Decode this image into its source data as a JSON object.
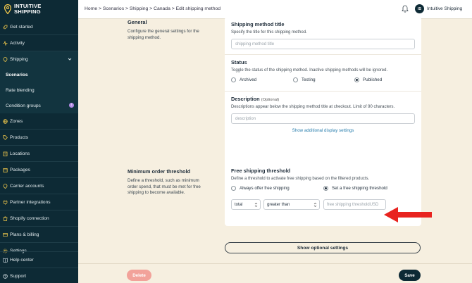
{
  "app": {
    "logo_line1": "Intuitive",
    "logo_line2": "Shipping"
  },
  "header": {
    "breadcrumb": "Home > Scenarios > Shipping > Canada > Edit shipping method",
    "avatar_initials": "IS",
    "user_name": "Intuitive Shipping"
  },
  "sidebar": {
    "items": [
      {
        "label": "Get started",
        "icon": "rocket-icon"
      },
      {
        "label": "Activity",
        "icon": "pulse-icon"
      },
      {
        "label": "Shipping",
        "icon": "pin-icon"
      },
      {
        "label": "Scenarios"
      },
      {
        "label": "Rate blending"
      },
      {
        "label": "Condition groups"
      },
      {
        "label": "Zones",
        "icon": "globe-icon"
      },
      {
        "label": "Products",
        "icon": "tag-icon"
      },
      {
        "label": "Locations",
        "icon": "building-icon"
      },
      {
        "label": "Packages",
        "icon": "box-icon"
      },
      {
        "label": "Carrier accounts",
        "icon": "pin-icon"
      },
      {
        "label": "Partner integrations",
        "icon": "plug-icon"
      },
      {
        "label": "Shopify connection",
        "icon": "bag-icon"
      },
      {
        "label": "Plans & billing",
        "icon": "card-icon"
      },
      {
        "label": "Settings",
        "icon": "gear-icon"
      }
    ],
    "bottom": [
      {
        "label": "Help center",
        "icon": "book-icon"
      },
      {
        "label": "Support",
        "icon": "help-icon"
      }
    ]
  },
  "general": {
    "heading": "General",
    "description": "Configure the general settings for the shipping method."
  },
  "method_title": {
    "title": "Shipping method title",
    "help": "Specify the title for this shipping method.",
    "placeholder": "shipping method title"
  },
  "status": {
    "title": "Status",
    "help": "Toggle the status of the shipping method. Inactive shipping methods will be ignored.",
    "options": [
      "Archived",
      "Testing",
      "Published"
    ],
    "selected": "Published"
  },
  "description": {
    "title": "Description",
    "optional": "(Optional)",
    "help": "Descriptions appear below the shipping method title at checkout. Limit of 90 characters.",
    "placeholder": "description",
    "link": "Show additional display settings"
  },
  "minimum": {
    "heading": "Minimum order threshold",
    "description": "Define a threshold, such as minimum order spend, that must be met for free shipping to become available."
  },
  "free_shipping": {
    "title": "Free shipping threshold",
    "help": "Define a threshold to activate free shipping based on the filtered products.",
    "options": [
      "Always offer free shipping",
      "Set a free shipping threshold"
    ],
    "selected": "Set a free shipping threshold",
    "metric": "total",
    "operator": "greater than",
    "value_placeholder": "free shipping threshold",
    "unit": "USD"
  },
  "actions": {
    "show_optional": "Show optional settings",
    "delete": "Delete",
    "save": "Save"
  },
  "colors": {
    "sidebar_bg": "#0d2a35",
    "page_bg": "#f6efe0",
    "accent_yellow": "#f2c94c",
    "delete_red": "#f2a29a",
    "arrow_red": "#e8231f"
  }
}
